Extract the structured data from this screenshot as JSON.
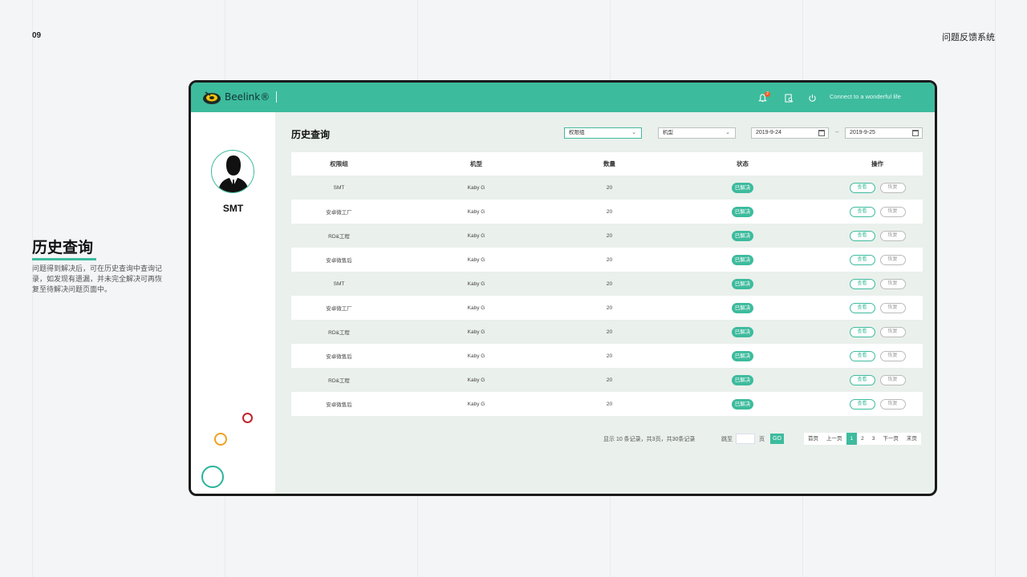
{
  "page_number": "09",
  "top_title": "问题反馈系统",
  "side": {
    "heading": "历史查询",
    "description": "问题得到解决后，可在历史查询中查询记录，如发现有遗漏，并未完全解决可再恢复至待解决问题页面中。"
  },
  "app": {
    "logo_text": "Beelink®",
    "notification_count": "2",
    "slogan": "Connect to a wonderful life",
    "user_name": "SMT",
    "colors": {
      "accent": "#3dbb9d",
      "background": "#eaf0ec"
    },
    "icons": [
      "bell-icon",
      "search-document-icon",
      "power-icon"
    ]
  },
  "main": {
    "title": "历史查询",
    "filters": {
      "group": "权限组",
      "model": "机型",
      "date_from": "2019-9-24",
      "date_to": "2019-9-25",
      "separator": "–"
    },
    "table": {
      "headers": [
        "权限组",
        "机型",
        "数量",
        "状态",
        "操作"
      ],
      "rows": [
        {
          "group": "SMT",
          "model": "Kaby G",
          "qty": "20",
          "status": "已解决"
        },
        {
          "group": "安卓微工厂",
          "model": "Kaby G",
          "qty": "20",
          "status": "已解决"
        },
        {
          "group": "RD&工程",
          "model": "Kaby G",
          "qty": "20",
          "status": "已解决"
        },
        {
          "group": "安卓微售后",
          "model": "Kaby G",
          "qty": "20",
          "status": "已解决"
        },
        {
          "group": "SMT",
          "model": "Kaby G",
          "qty": "20",
          "status": "已解决"
        },
        {
          "group": "安卓微工厂",
          "model": "Kaby G",
          "qty": "20",
          "status": "已解决"
        },
        {
          "group": "RD&工程",
          "model": "Kaby G",
          "qty": "20",
          "status": "已解决"
        },
        {
          "group": "安卓微售后",
          "model": "Kaby G",
          "qty": "20",
          "status": "已解决"
        },
        {
          "group": "RD&工程",
          "model": "Kaby G",
          "qty": "20",
          "status": "已解决"
        },
        {
          "group": "安卓微售后",
          "model": "Kaby G",
          "qty": "20",
          "status": "已解决"
        }
      ],
      "view_label": "查看",
      "restore_label": "恢复"
    },
    "pagination": {
      "summary": "显示 10 条记录，共3页，共30条记录",
      "jump_label": "跳至",
      "page_unit": "页",
      "go": "GO",
      "first": "首页",
      "prev": "上一页",
      "pages": [
        "1",
        "2",
        "3"
      ],
      "current": "1",
      "next": "下一页",
      "last": "末页"
    }
  }
}
